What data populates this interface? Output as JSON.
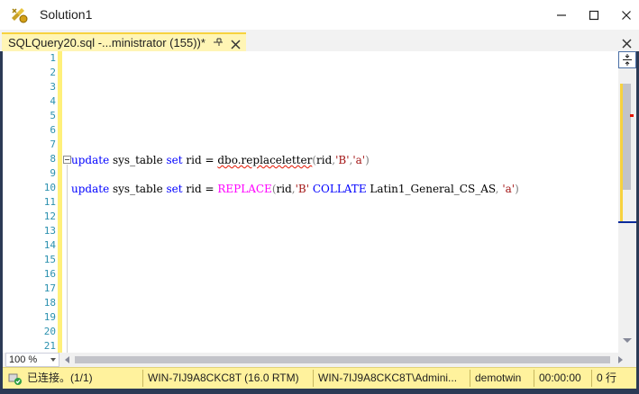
{
  "window": {
    "title": "Solution1"
  },
  "tab": {
    "label": "SQLQuery20.sql -...ministrator (155))*"
  },
  "editor": {
    "line_numbers": [
      "1",
      "2",
      "3",
      "4",
      "5",
      "6",
      "7",
      "8",
      "9",
      "10",
      "11",
      "12",
      "13",
      "14",
      "15",
      "16",
      "17",
      "18",
      "19",
      "20",
      "21"
    ],
    "line8": {
      "kw1": "update",
      "t1": " sys_table ",
      "kw2": "set",
      "t2": " rid = ",
      "fn": "dbo.replaceletter",
      "p1": "(",
      "t3": "rid",
      "p2": ",",
      "s1": "'B'",
      "p3": ",",
      "s2": "'a'",
      "p4": ")"
    },
    "line10": {
      "kw1": "update",
      "t1": " sys_table ",
      "kw2": "set",
      "t2": " rid = ",
      "fn": "REPLACE",
      "p1": "(",
      "t3": "rid",
      "p2": ",",
      "s1": "'B'",
      "t4": " ",
      "kw3": "COLLATE",
      "t5": " Latin1_General_CS_AS",
      "p3": ",",
      "t6": " ",
      "s2": "'a'",
      "p4": ")"
    }
  },
  "zoom": {
    "value": "100 %"
  },
  "status": {
    "connection": "已连接。(1/1)",
    "server": "WIN-7IJ9A8CKC8T (16.0 RTM)",
    "user": "WIN-7IJ9A8CKC8T\\Admini...",
    "database": "demotwin",
    "elapsed": "00:00:00",
    "rows": "0 行"
  },
  "colors": {
    "accent_yellow": "#fff29d",
    "tab_active": "#fff5b5",
    "keyword": "#0000ff",
    "string": "#a31515",
    "function": "#ff00ff",
    "line_number": "#2b91af"
  },
  "icons": [
    "ssms-app-icon",
    "minimize-icon",
    "maximize-icon",
    "close-icon",
    "pin-icon",
    "tab-close-icon",
    "split-view-icon",
    "connected-icon"
  ]
}
